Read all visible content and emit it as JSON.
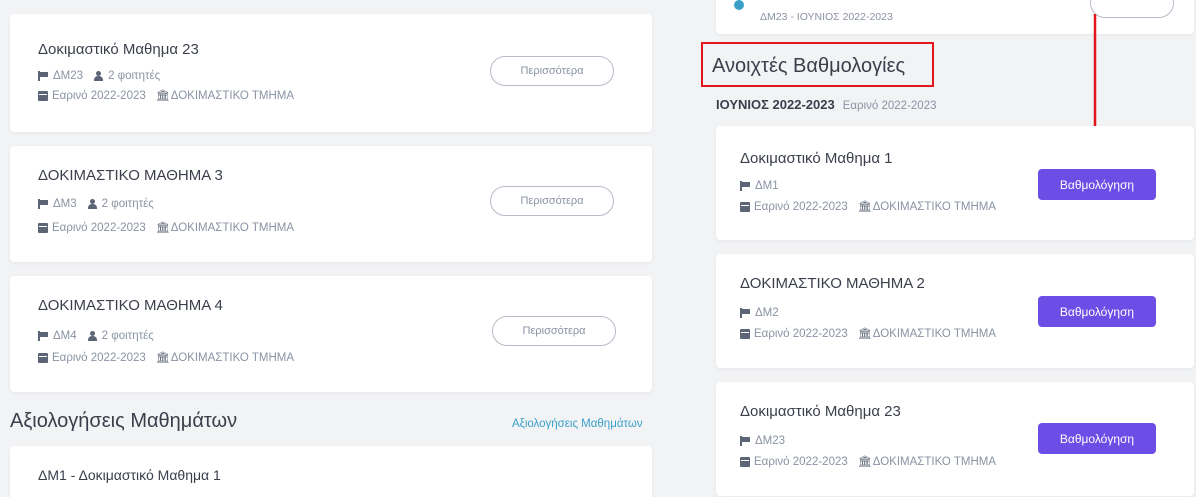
{
  "left_courses": [
    {
      "title": "Δοκιμαστικό Μαθημα 23",
      "code": "ΔΜ23",
      "students": "2 φοιτητές",
      "semester": "Εαρινό 2022-2023",
      "department": "ΔΟΚΙΜΑΣΤΙΚΟ ΤΜΗΜΑ",
      "more_label": "Περισσότερα"
    },
    {
      "title": "ΔΟΚΙΜΑΣΤΙΚΟ ΜΑΘΗΜΑ 3",
      "code": "ΔΜ3",
      "students": "2 φοιτητές",
      "semester": "Εαρινό 2022-2023",
      "department": "ΔΟΚΙΜΑΣΤΙΚΟ ΤΜΗΜΑ",
      "more_label": "Περισσότερα"
    },
    {
      "title": "ΔΟΚΙΜΑΣΤΙΚΟ ΜΑΘΗΜΑ 4",
      "code": "ΔΜ4",
      "students": "2 φοιτητές",
      "semester": "Εαρινό 2022-2023",
      "department": "ΔΟΚΙΜΑΣΤΙΚΟ ΤΜΗΜΑ",
      "more_label": "Περισσότερα"
    }
  ],
  "evaluations": {
    "title": "Αξιολογήσεις Μαθημάτων",
    "link": "Αξιολογήσεις Μαθημάτων",
    "first_item": "ΔΜ1 - Δοκιμαστικό Μαθημα 1"
  },
  "top_right_partial": {
    "text": "ΔΜ23 - ΙΟΥΝΙΟΣ 2022-2023"
  },
  "open_grades": {
    "title": "Ανοιχτές Βαθμολογίες",
    "period": "ΙΟΥΝΙΟΣ 2022-2023",
    "period_sub": "Εαρινό 2022-2023",
    "courses": [
      {
        "title": "Δοκιμαστικό Μαθημα 1",
        "code": "ΔΜ1",
        "semester": "Εαρινό 2022-2023",
        "department": "ΔΟΚΙΜΑΣΤΙΚΟ ΤΜΗΜΑ",
        "button": "Βαθμολόγηση"
      },
      {
        "title": "ΔΟΚΙΜΑΣΤΙΚΟ ΜΑΘΗΜΑ 2",
        "code": "ΔΜ2",
        "semester": "Εαρινό 2022-2023",
        "department": "ΔΟΚΙΜΑΣΤΙΚΟ ΤΜΗΜΑ",
        "button": "Βαθμολόγηση"
      },
      {
        "title": "Δοκιμαστικό Μαθημα 23",
        "code": "ΔΜ23",
        "semester": "Εαρινό 2022-2023",
        "department": "ΔΟΚΙΜΑΣΤΙΚΟ ΤΜΗΜΑ",
        "button": "Βαθμολόγηση"
      }
    ]
  },
  "colors": {
    "accent": "#6c4de6",
    "annotation_red": "#e2161b",
    "link": "#3aa0c9"
  }
}
